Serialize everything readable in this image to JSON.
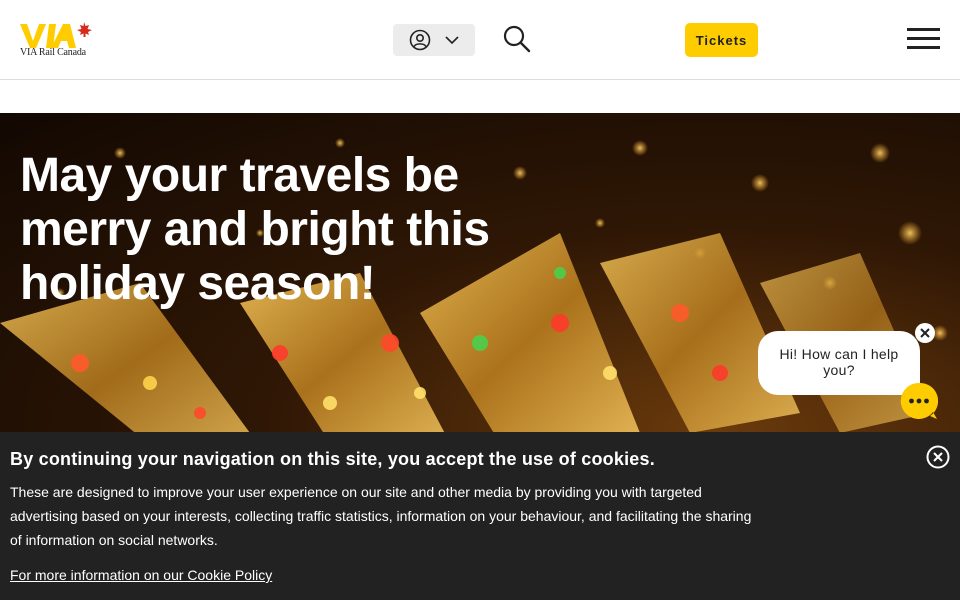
{
  "header": {
    "logo_text": "VIA Rail Canada",
    "tickets_label": "Tickets"
  },
  "hero": {
    "title": "May your travels be merry and bright this holiday season!"
  },
  "chat": {
    "greeting": "Hi! How can I help you?"
  },
  "cookie_banner": {
    "title": "By continuing your navigation on this site, you accept the use of cookies.",
    "body": "These are designed to improve your user experience on our site and other media by providing you with targeted advertising based on your interests, collecting traffic statistics, information on your behaviour, and facilitating the sharing of information on social networks.",
    "policy_link": "For more information on our Cookie Policy"
  },
  "colors": {
    "brand_yellow": "#ffcc00",
    "maple_red": "#d52b1e",
    "banner_bg": "#222222"
  },
  "icons": {
    "account": "user-circle-icon",
    "chevron": "chevron-down-icon",
    "search": "search-icon",
    "menu": "hamburger-menu-icon",
    "chat": "chat-dots-icon",
    "close": "close-icon"
  }
}
